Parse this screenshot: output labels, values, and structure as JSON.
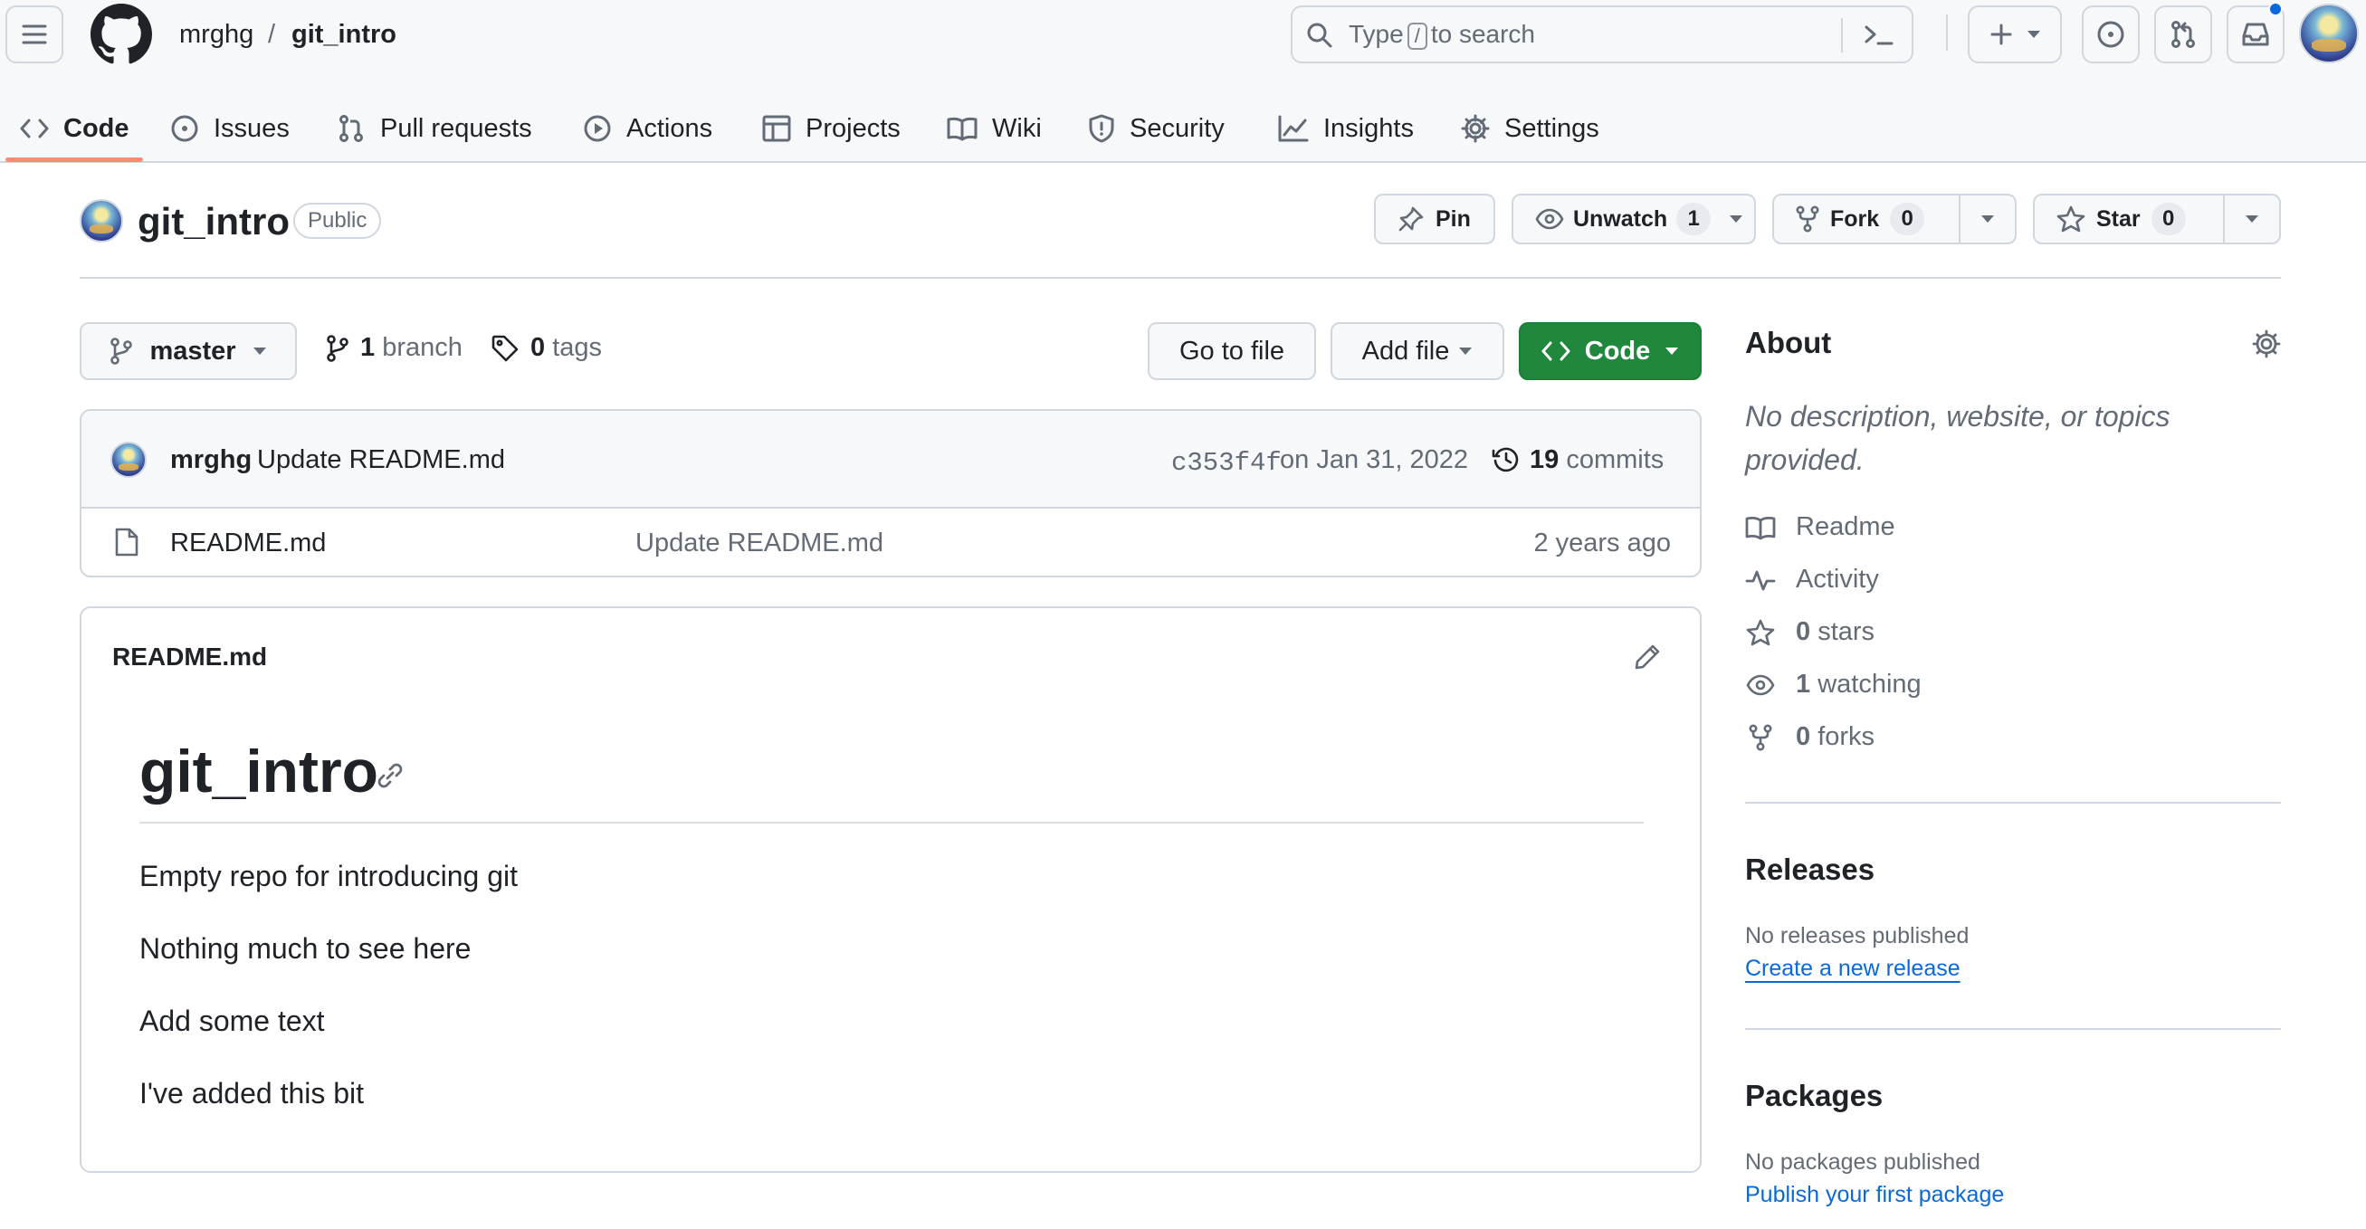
{
  "header": {
    "owner": "mrghg",
    "separator": "/",
    "repo": "git_intro",
    "search": {
      "before": "Type",
      "key": "/",
      "after": "to search"
    }
  },
  "tabs": [
    {
      "label": "Code",
      "icon": "code-icon"
    },
    {
      "label": "Issues",
      "icon": "issue-icon"
    },
    {
      "label": "Pull requests",
      "icon": "pull-request-icon"
    },
    {
      "label": "Actions",
      "icon": "play-icon"
    },
    {
      "label": "Projects",
      "icon": "table-icon"
    },
    {
      "label": "Wiki",
      "icon": "book-icon"
    },
    {
      "label": "Security",
      "icon": "shield-icon"
    },
    {
      "label": "Insights",
      "icon": "graph-icon"
    },
    {
      "label": "Settings",
      "icon": "gear-icon"
    }
  ],
  "repo": {
    "name": "git_intro",
    "visibility": "Public",
    "pin": "Pin",
    "unwatch": "Unwatch",
    "watch_count": "1",
    "fork": "Fork",
    "fork_count": "0",
    "star": "Star",
    "star_count": "0"
  },
  "toolbar": {
    "branch": "master",
    "branch_count": "1",
    "branch_label": "branch",
    "tag_count": "0",
    "tag_label": "tags",
    "go_to_file": "Go to file",
    "add_file": "Add file",
    "code": "Code"
  },
  "commit": {
    "author": "mrghg",
    "message": "Update README.md",
    "sha": "c353f4f",
    "date": "on Jan 31, 2022",
    "count": "19",
    "count_label": "commits"
  },
  "files": [
    {
      "name": "README.md",
      "message": "Update README.md",
      "age": "2 years ago"
    }
  ],
  "readme": {
    "filename": "README.md",
    "heading": "git_intro",
    "paragraphs": [
      "Empty repo for introducing git",
      "Nothing much to see here",
      "Add some text",
      "I've added this bit"
    ]
  },
  "about": {
    "title": "About",
    "description": "No description, website, or topics provided.",
    "readme": "Readme",
    "activity": "Activity",
    "stars_count": "0",
    "stars_label": "stars",
    "watching_count": "1",
    "watching_label": "watching",
    "forks_count": "0",
    "forks_label": "forks"
  },
  "releases": {
    "title": "Releases",
    "empty": "No releases published",
    "link": "Create a new release"
  },
  "packages": {
    "title": "Packages",
    "empty": "No packages published",
    "link": "Publish your first package"
  },
  "colors": {
    "accent_green": "#1f883d",
    "link_blue": "#0969da",
    "tab_underline": "#fd8c73",
    "notification_dot": "#0969da"
  }
}
